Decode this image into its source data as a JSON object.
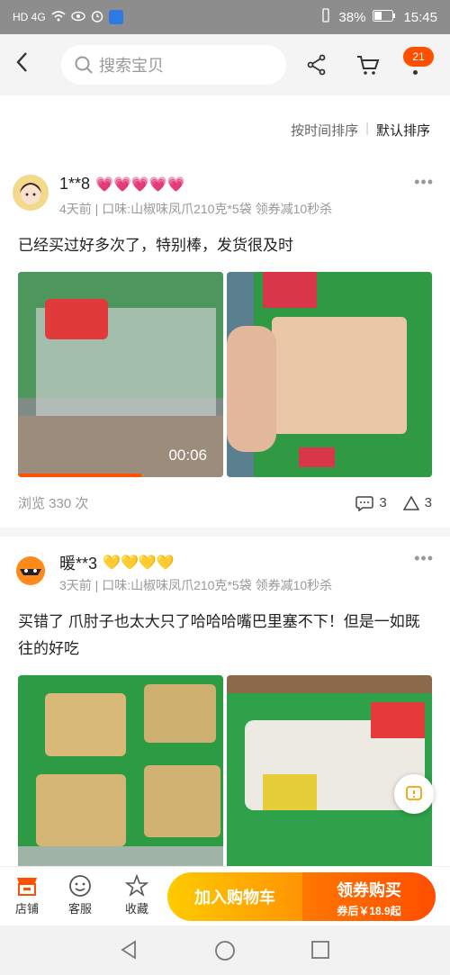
{
  "status": {
    "signal": "HD 4G",
    "battery": "38%",
    "time": "15:45"
  },
  "search": {
    "placeholder": "搜索宝贝"
  },
  "cart_badge": "21",
  "sort": {
    "by_time": "按时间排序",
    "default": "默认排序"
  },
  "reviews": [
    {
      "user": "1**8",
      "level_icons": "💗💗💗💗💗",
      "meta": "4天前 | 口味:山椒味凤爪210克*5袋 领券减10秒杀",
      "text": "已经买过好多次了，特别棒，发货很及时",
      "video_time": "00:06",
      "video_progress": 0.6,
      "views": "浏览 330 次",
      "comments": "3",
      "likes": "3"
    },
    {
      "user": "暖**3",
      "level_icons": "💛💛💛💛",
      "meta": "3天前 | 口味:山椒味凤爪210克*5袋 领券减10秒杀",
      "text": "买错了 爪肘子也太大只了哈哈哈嘴巴里塞不下！但是一如既往的好吃"
    }
  ],
  "bottom": {
    "shop": "店铺",
    "service": "客服",
    "favorite": "收藏",
    "add_cart": "加入购物车",
    "buy": "领券购买",
    "buy_sub": "券后￥18.9起"
  },
  "colors": {
    "accent": "#ff5000",
    "brand_yellow": "#ffcb00"
  }
}
